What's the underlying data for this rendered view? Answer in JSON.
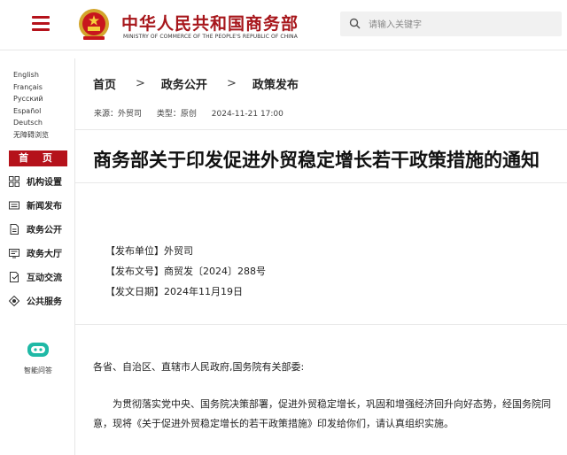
{
  "header": {
    "site_title": "中华人民共和国商务部",
    "site_subtitle": "MINISTRY OF COMMERCE OF THE PEOPLE'S REPUBLIC OF CHINA",
    "search_placeholder": "请输入关键字"
  },
  "sidebar": {
    "languages": [
      "English",
      "Français",
      "Русский",
      "Español",
      "Deutsch",
      "无障碍浏览"
    ],
    "home_label": "首 页",
    "items": [
      {
        "label": "机构设置",
        "icon": "grid-icon"
      },
      {
        "label": "新闻发布",
        "icon": "news-icon"
      },
      {
        "label": "政务公开",
        "icon": "document-icon"
      },
      {
        "label": "政务大厅",
        "icon": "hall-icon"
      },
      {
        "label": "互动交流",
        "icon": "chat-icon"
      },
      {
        "label": "公共服务",
        "icon": "service-icon"
      }
    ],
    "assistant_label": "智能问答"
  },
  "breadcrumb": {
    "home": "首页",
    "level1": "政务公开",
    "level2": "政策发布",
    "separator": ">"
  },
  "article": {
    "source": "来源：外贸司",
    "type": "类型：原创",
    "date": "2024-11-21 17:00",
    "title": "商务部关于印发促进外贸稳定增长若干政策措施的通知",
    "issuer": "【发布单位】外贸司",
    "doc_number": "【发布文号】商贸发〔2024〕288号",
    "issue_date": "【发文日期】2024年11月19日",
    "salutation": "各省、自治区、直辖市人民政府,国务院有关部委:",
    "paragraph": "为贯彻落实党中央、国务院决策部署，促进外贸稳定增长，巩固和增强经济回升向好态势，经国务院同意，现将《关于促进外贸稳定增长的若干政策措施》印发给你们，请认真组织实施。"
  },
  "colors": {
    "accent": "#b5121b",
    "title_red": "#a7161b",
    "assistant": "#1fb9a6"
  }
}
